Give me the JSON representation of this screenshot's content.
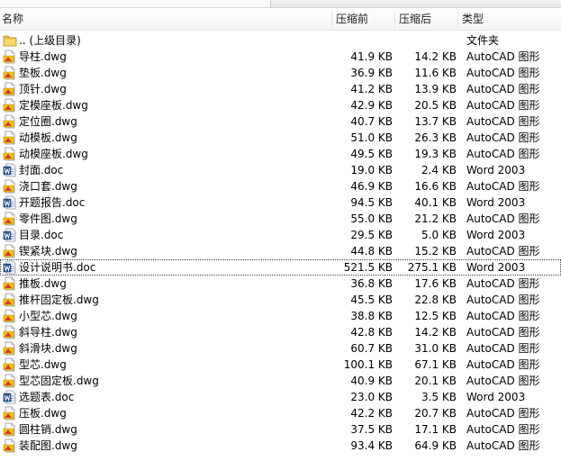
{
  "header": {
    "name_label": "名称",
    "before_label": "压缩前",
    "after_label": "压缩后",
    "type_label": "类型"
  },
  "files": [
    {
      "name": ".. (上级目录)",
      "before": "",
      "after": "",
      "type": "文件夹",
      "icon": "folder-icon"
    },
    {
      "name": "导柱.dwg",
      "before": "41.9 KB",
      "after": "14.2 KB",
      "type": "AutoCAD 图形",
      "icon": "dwg-file-icon"
    },
    {
      "name": "垫板.dwg",
      "before": "36.9 KB",
      "after": "11.6 KB",
      "type": "AutoCAD 图形",
      "icon": "dwg-file-icon"
    },
    {
      "name": "顶针.dwg",
      "before": "41.2 KB",
      "after": "13.9 KB",
      "type": "AutoCAD 图形",
      "icon": "dwg-file-icon"
    },
    {
      "name": "定模座板.dwg",
      "before": "42.9 KB",
      "after": "20.5 KB",
      "type": "AutoCAD 图形",
      "icon": "dwg-file-icon"
    },
    {
      "name": "定位圈.dwg",
      "before": "40.7 KB",
      "after": "13.7 KB",
      "type": "AutoCAD 图形",
      "icon": "dwg-file-icon"
    },
    {
      "name": "动模板.dwg",
      "before": "51.0 KB",
      "after": "26.3 KB",
      "type": "AutoCAD 图形",
      "icon": "dwg-file-icon"
    },
    {
      "name": "动模座板.dwg",
      "before": "49.5 KB",
      "after": "19.3 KB",
      "type": "AutoCAD 图形",
      "icon": "dwg-file-icon"
    },
    {
      "name": "封面.doc",
      "before": "19.0 KB",
      "after": "2.4 KB",
      "type": "Word 2003",
      "icon": "word-file-icon"
    },
    {
      "name": "浇口套.dwg",
      "before": "46.9 KB",
      "after": "16.6 KB",
      "type": "AutoCAD 图形",
      "icon": "dwg-file-icon"
    },
    {
      "name": "开题报告.doc",
      "before": "94.5 KB",
      "after": "40.1 KB",
      "type": "Word 2003",
      "icon": "word-file-icon"
    },
    {
      "name": "零件图.dwg",
      "before": "55.0 KB",
      "after": "21.2 KB",
      "type": "AutoCAD 图形",
      "icon": "dwg-file-icon"
    },
    {
      "name": "目录.doc",
      "before": "29.5 KB",
      "after": "5.0 KB",
      "type": "Word 2003",
      "icon": "word-file-icon"
    },
    {
      "name": "锲紧块.dwg",
      "before": "44.8 KB",
      "after": "15.2 KB",
      "type": "AutoCAD 图形",
      "icon": "dwg-file-icon"
    },
    {
      "name": "设计说明书.doc",
      "before": "521.5 KB",
      "after": "275.1 KB",
      "type": "Word 2003",
      "icon": "word-file-icon",
      "selected": true
    },
    {
      "name": "推板.dwg",
      "before": "36.8 KB",
      "after": "17.6 KB",
      "type": "AutoCAD 图形",
      "icon": "dwg-file-icon"
    },
    {
      "name": "推杆固定板.dwg",
      "before": "45.5 KB",
      "after": "22.8 KB",
      "type": "AutoCAD 图形",
      "icon": "dwg-file-icon"
    },
    {
      "name": "小型芯.dwg",
      "before": "38.8 KB",
      "after": "12.5 KB",
      "type": "AutoCAD 图形",
      "icon": "dwg-file-icon"
    },
    {
      "name": "斜导柱.dwg",
      "before": "42.8 KB",
      "after": "14.2 KB",
      "type": "AutoCAD 图形",
      "icon": "dwg-file-icon"
    },
    {
      "name": "斜滑块.dwg",
      "before": "60.7 KB",
      "after": "31.0 KB",
      "type": "AutoCAD 图形",
      "icon": "dwg-file-icon"
    },
    {
      "name": "型芯.dwg",
      "before": "100.1 KB",
      "after": "67.1 KB",
      "type": "AutoCAD 图形",
      "icon": "dwg-file-icon"
    },
    {
      "name": "型芯固定板.dwg",
      "before": "40.9 KB",
      "after": "20.1 KB",
      "type": "AutoCAD 图形",
      "icon": "dwg-file-icon"
    },
    {
      "name": "选题表.doc",
      "before": "23.0 KB",
      "after": "3.5 KB",
      "type": "Word 2003",
      "icon": "word-file-icon"
    },
    {
      "name": "压板.dwg",
      "before": "42.2 KB",
      "after": "20.7 KB",
      "type": "AutoCAD 图形",
      "icon": "dwg-file-icon"
    },
    {
      "name": "圆柱销.dwg",
      "before": "37.5 KB",
      "after": "17.1 KB",
      "type": "AutoCAD 图形",
      "icon": "dwg-file-icon"
    },
    {
      "name": "装配图.dwg",
      "before": "93.4 KB",
      "after": "64.9 KB",
      "type": "AutoCAD 图形",
      "icon": "dwg-file-icon"
    }
  ]
}
